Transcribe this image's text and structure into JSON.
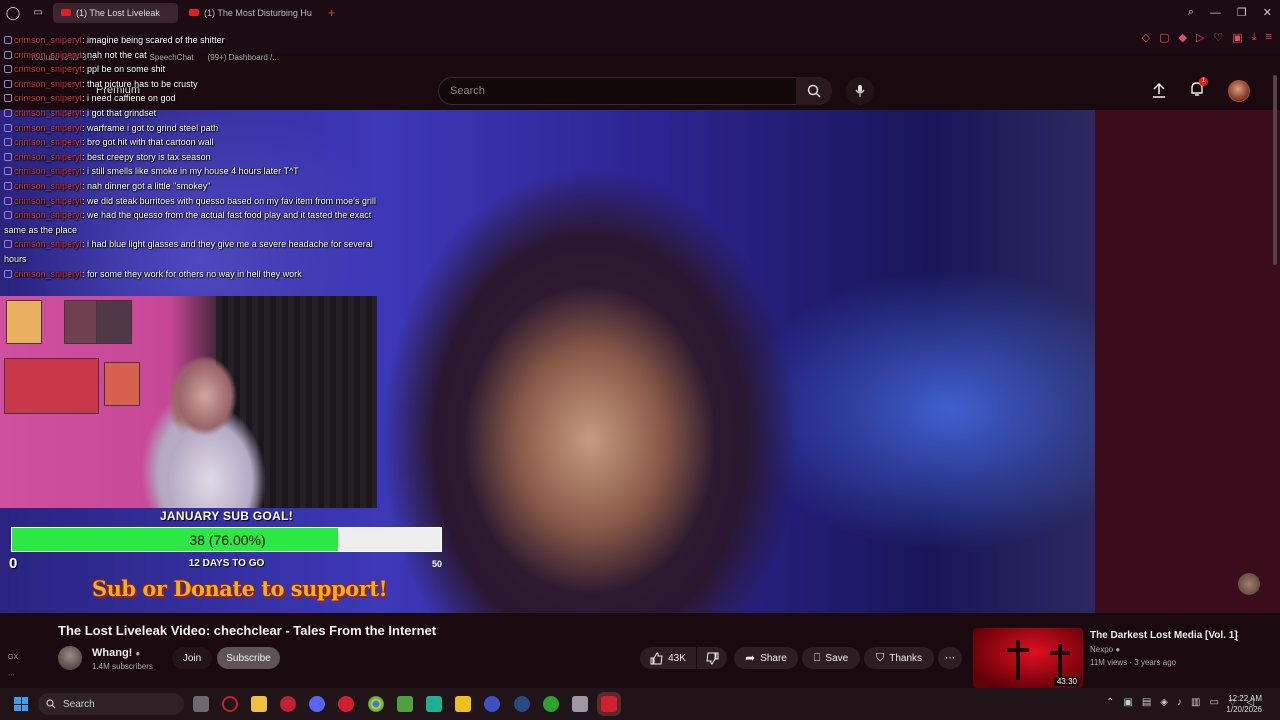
{
  "browser": {
    "tabs": [
      {
        "label": "(1) The Lost Liveleak",
        "active": true
      },
      {
        "label": "(1) The Most Disturbing Hu",
        "active": false
      }
    ],
    "new_tab": "+",
    "bookmarks": [
      "Youtube to MP3 ...",
      "SpeechChat",
      "(99+) Dashboard /..."
    ]
  },
  "youtube_header": {
    "premium_label": "Premium",
    "search_placeholder": "Search",
    "notification_count": "1"
  },
  "chat": {
    "username": "crimson_sniperyt",
    "messages": [
      "imagine being scared of the shitter",
      "nah not the cat",
      "ppl be on some shit",
      "that picture has to be crusty",
      "i need caffiene on god",
      "i got that grindset",
      "warframe i got to grind steel path",
      "bro got hit with that cartoon wall",
      "best creepy story is tax season",
      "i still smells like smoke in my house 4 hours later T^T",
      "nah dinner got a little \"smokey\"",
      "we did steak burritoes with quesso based on my fav item from moe's grill",
      "we had the quesso from the actual fast food play and it tasted the exact same as the place",
      "i had blue light glasses and they give me a severe headache for several hours",
      "for some they work for others no way in hell they work"
    ]
  },
  "sub_goal": {
    "title": "JANUARY SUB GOAL!",
    "progress_text": "38 (76.00%)",
    "progress_fraction": 0.76,
    "min": "0",
    "max": "50",
    "days_left": "12 DAYS TO GO",
    "support_text": "Sub or Donate to support!"
  },
  "video": {
    "title": "The Lost Liveleak Video: chechclear - Tales From the Internet",
    "channel": "Whang!",
    "subscribers": "1.4M subscribers",
    "join_label": "Join",
    "subscribe_label": "Subscribe",
    "likes": "43K",
    "share_label": "Share",
    "save_label": "Save",
    "thanks_label": "Thanks"
  },
  "recommendation": {
    "title": "The Darkest Lost Media [Vol. 1]",
    "channel": "Nexpo",
    "meta": "11M views · 3 years ago",
    "duration": "43:30"
  },
  "taskbar": {
    "search_label": "Search",
    "time": "12:22 AM",
    "date": "1/20/2026"
  },
  "colors": {
    "goal_fill": "#2ce844",
    "chat_user": "#d93040",
    "accent": "#e02020"
  }
}
